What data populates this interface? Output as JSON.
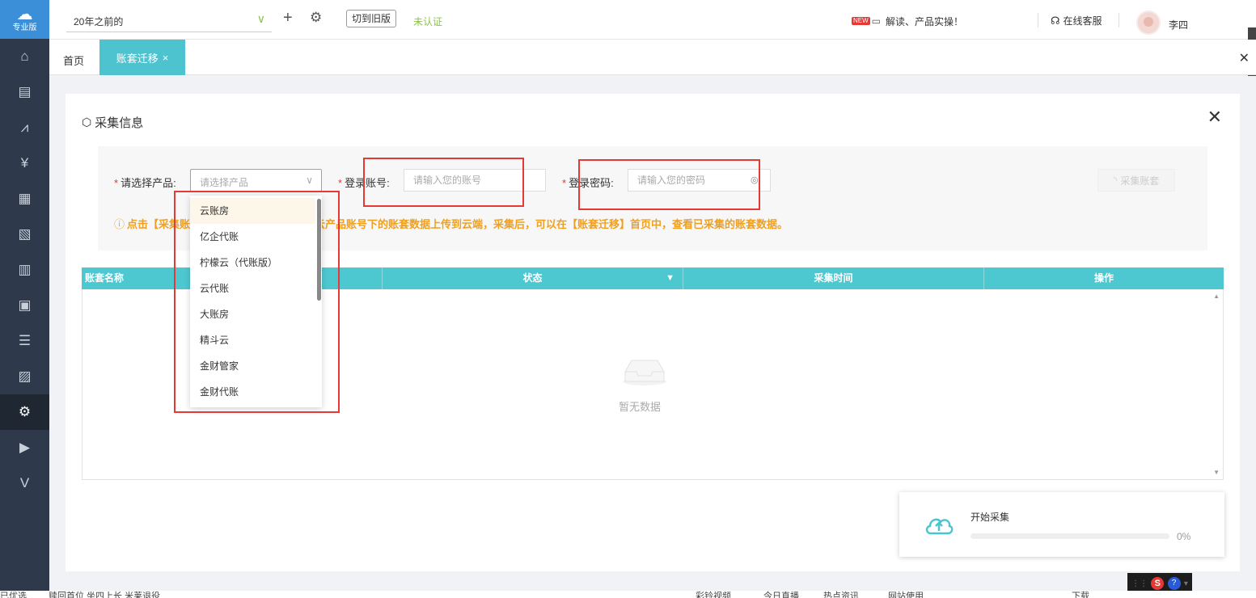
{
  "logo": {
    "text": "专业版",
    "icon": "cloud-plus-icon"
  },
  "sidebar": {
    "items": [
      {
        "name": "home-icon",
        "glyph": "⌂"
      },
      {
        "name": "voucher-icon",
        "glyph": "▤"
      },
      {
        "name": "chart-icon",
        "glyph": "⩘"
      },
      {
        "name": "money-bag-icon",
        "glyph": "¥"
      },
      {
        "name": "ledger-icon",
        "glyph": "▦"
      },
      {
        "name": "report-icon",
        "glyph": "▧"
      },
      {
        "name": "invoice-icon",
        "glyph": "▥"
      },
      {
        "name": "asset-icon",
        "glyph": "▣"
      },
      {
        "name": "payroll-icon",
        "glyph": "☰"
      },
      {
        "name": "tax-icon",
        "glyph": "▨"
      },
      {
        "name": "settings-icon",
        "glyph": "⚙",
        "active": true
      },
      {
        "name": "video-icon",
        "glyph": "▶"
      },
      {
        "name": "vip-icon",
        "glyph": "V"
      }
    ]
  },
  "header": {
    "period": "20年之前的",
    "old_version_label": "切到旧版",
    "status": "未认证",
    "news_badge": "NEW",
    "news_text": "解读、产品实操！",
    "service_label": "在线客服",
    "username": "李四"
  },
  "tabs": {
    "home": "首页",
    "active": "账套迁移",
    "close_glyph": "×",
    "bar_close_glyph": "✕"
  },
  "panel": {
    "title": "采集信息",
    "close_glyph": "✕",
    "product_label": "请选择产品:",
    "product_placeholder": "请选择产品",
    "account_label": "登录账号:",
    "account_placeholder": "请输入您的账号",
    "password_label": "登录密码:",
    "password_placeholder": "请输入您的密码",
    "collect_button": "采集账套",
    "notice_left": "点击【采集账",
    "notice_right": "对应云产品账号下的账套数据上传到云端，采集后，可以在【账套迁移】首页中，查看已采集的账套数据。"
  },
  "table": {
    "columns": [
      "账套名称",
      "状态",
      "采集时间",
      "操作"
    ],
    "empty_text": "暂无数据"
  },
  "dropdown": {
    "options": [
      "云账房",
      "亿企代账",
      "柠檬云（代账版）",
      "云代账",
      "大账房",
      "精斗云",
      "金财管家",
      "金财代账"
    ],
    "hover_index": 0
  },
  "toast": {
    "title": "开始采集",
    "progress_percent": 0,
    "progress_text": "0%"
  },
  "ime": {
    "s": "S",
    "help": "?"
  },
  "taskbar": {
    "items": [
      "已优选",
      "赎回首位  坐四上长  米莱退役",
      "彩铃视频",
      "今日直播",
      "热点资讯",
      "网站使用",
      "下载"
    ]
  },
  "colors": {
    "sidebar": "#2e3a4b",
    "accent": "#4ec3d0",
    "table_head": "#4ec8d0",
    "warning": "#f0a020",
    "annotation": "#e53935"
  }
}
